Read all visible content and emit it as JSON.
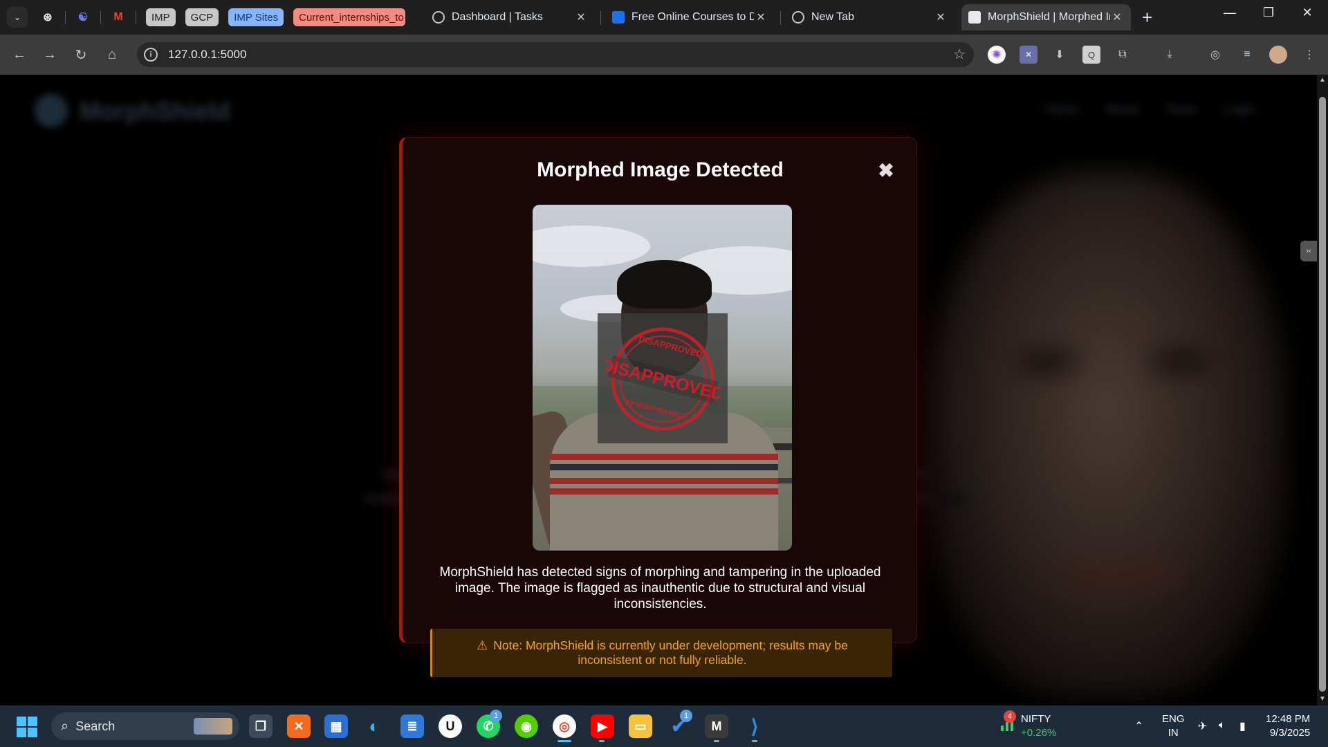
{
  "browser": {
    "bookmarks": [
      "IMP",
      "GCP",
      "IMP Sites",
      "Current_internships_to"
    ],
    "tabs": [
      {
        "title": "Dashboard | Tasks",
        "active": false
      },
      {
        "title": "Free Online Courses to Do",
        "active": false
      },
      {
        "title": "New Tab",
        "active": false
      },
      {
        "title": "MorphShield | Morphed Image",
        "active": true
      }
    ],
    "new_tab": "+",
    "close_glyph": "✕",
    "url": "127.0.0.1:5000",
    "window_controls": {
      "minimize": "—",
      "restore": "❐",
      "close": "✕"
    }
  },
  "site": {
    "logo_name": "MorphShield",
    "nav": [
      "Home",
      "About",
      "Team",
      "Login"
    ]
  },
  "modal": {
    "title": "Morphed Image Detected",
    "close": "✖",
    "stamp_main": "DISAPPROVED",
    "stamp_top": "DISAPPROVED",
    "stamp_bottom": "BY MORPHSHIELD",
    "message": "MorphShield has detected signs of morphing and tampering in the uploaded image. The image is flagged as inauthentic due to structural and visual inconsistencies.",
    "note_icon": "⚠",
    "note": "Note: MorphShield is currently under development; results may be inconsistent or not fully reliable."
  },
  "taskbar": {
    "search_label": "Search",
    "whatsapp_badge": "1",
    "todo_badge": "1",
    "nifty_badge": "4",
    "nifty_name": "NIFTY",
    "nifty_change": "+0.26%",
    "lang_top": "ENG",
    "lang_bottom": "IN",
    "time": "12:48 PM",
    "date": "9/3/2025"
  },
  "colors": {
    "modal_border_accent": "#b01414",
    "note_text": "#f2a51a",
    "stamp_red": "#c8202a"
  }
}
